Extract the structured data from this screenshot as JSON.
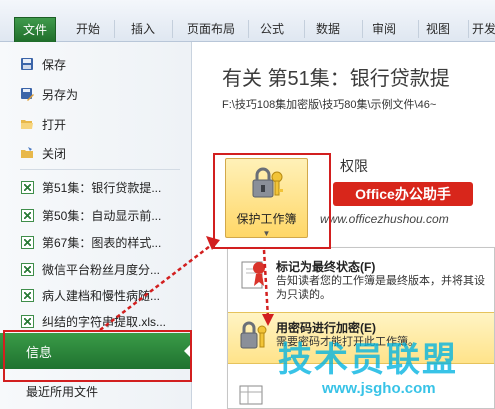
{
  "ribbon": {
    "tabs": [
      "文件",
      "开始",
      "插入",
      "页面布局",
      "公式",
      "数据",
      "审阅",
      "视图",
      "开发"
    ]
  },
  "nav": {
    "save": "保存",
    "save_as": "另存为",
    "open": "打开",
    "close": "关闭",
    "recent_files": [
      "第51集：银行贷款提...",
      "第50集：自动显示前...",
      "第67集：图表的样式...",
      "微信平台粉丝月度分...",
      "病人建档和慢性病随...",
      "纠结的字符串提取.xls..."
    ],
    "info": "信息",
    "recent": "最近所用文件"
  },
  "content": {
    "title": "有关 第51集：银行贷款提",
    "path": "F:\\技巧108集加密版\\技巧80集\\示例文件\\46~",
    "permissions_heading": "权限",
    "protect_button": "保护工作簿",
    "brand_badge": "Office办公助手",
    "brand_url": "www.officezhushou.com"
  },
  "dropdown": {
    "mark_final_title": "标记为最终状态(F)",
    "mark_final_desc": "告知读者您的工作簿是最终版本，并将其设为只读的。",
    "encrypt_title": "用密码进行加密(E)",
    "encrypt_desc": "需要密码才能打开此工作簿。"
  },
  "watermark": {
    "text": "技术员联盟",
    "url": "www.jsgho.com"
  },
  "colors": {
    "file_tab": "#2a8236",
    "info_tab": "#2a8a3a",
    "highlight": "#ffd767",
    "annotation_red": "#d21f1f"
  }
}
